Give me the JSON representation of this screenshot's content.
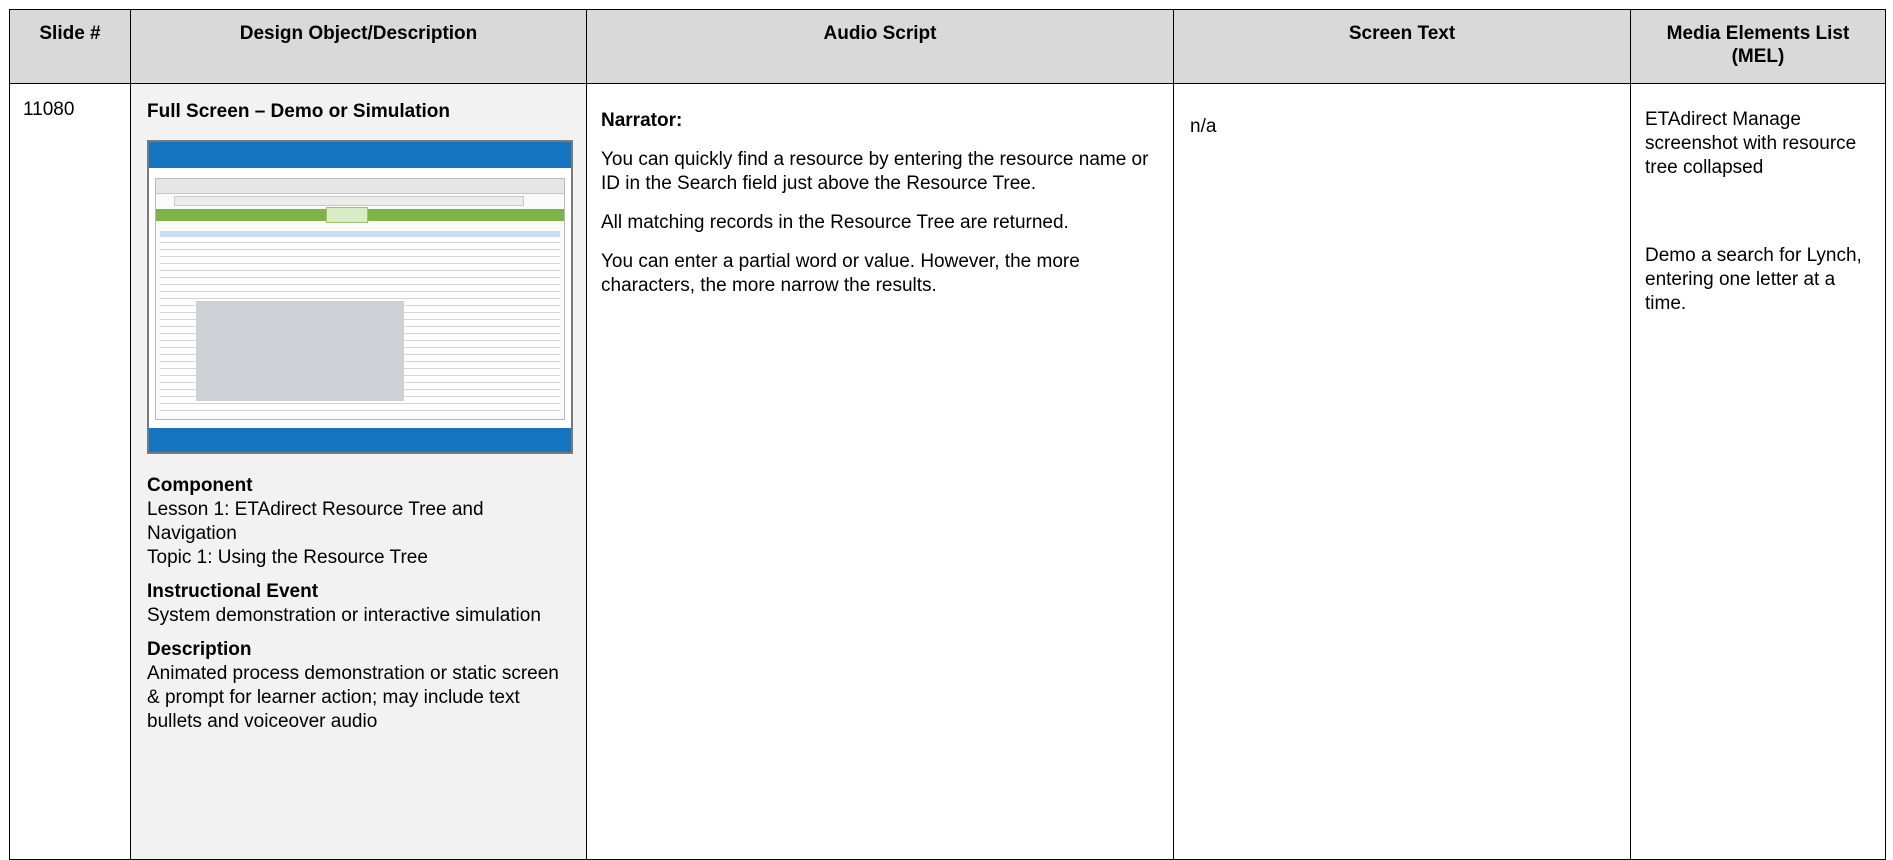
{
  "headers": {
    "slide": "Slide #",
    "design": "Design Object/Description",
    "audio": "Audio Script",
    "screen": "Screen Text",
    "mel": "Media Elements List (MEL)"
  },
  "row": {
    "slide_number": "11080",
    "design": {
      "title": "Full Screen – Demo or Simulation",
      "component_heading": "Component",
      "component_line1": "Lesson 1: ETAdirect Resource Tree and Navigation",
      "component_line2": "Topic 1: Using the Resource Tree",
      "event_heading": "Instructional Event",
      "event_text": "System demonstration or interactive simulation",
      "description_heading": "Description",
      "description_text": "Animated process demonstration or static screen & prompt for learner action; may include text bullets and voiceover audio"
    },
    "audio": {
      "narrator_label": "Narrator:",
      "paragraphs": [
        "You can quickly find a resource by entering the resource name or ID in the Search field just above the Resource Tree.",
        "All matching records in the Resource Tree are returned.",
        "You can enter a partial word or value. However, the more characters, the more narrow the results."
      ]
    },
    "screen_text": "n/a",
    "mel": {
      "item1": "ETAdirect Manage screenshot with resource tree collapsed",
      "item2": "Demo a search for Lynch, entering one letter at a time."
    }
  }
}
